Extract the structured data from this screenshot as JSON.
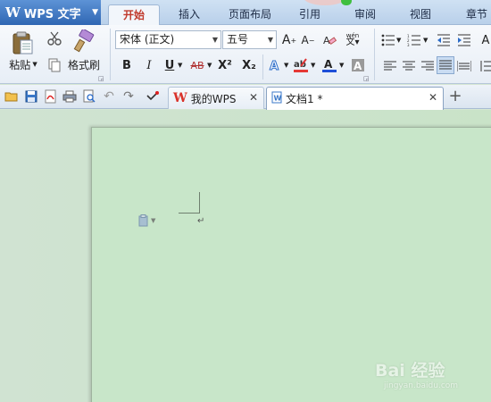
{
  "app": {
    "brand": "WPS 文字",
    "logo_glyph": "W"
  },
  "menu": {
    "tabs": [
      {
        "label": "开始",
        "active": true
      },
      {
        "label": "插入"
      },
      {
        "label": "页面布局"
      },
      {
        "label": "引用"
      },
      {
        "label": "审阅"
      },
      {
        "label": "视图"
      },
      {
        "label": "章节"
      }
    ]
  },
  "ribbon": {
    "paste_label": "粘贴",
    "format_painter_label": "格式刷",
    "font_name": "宋体 (正文)",
    "font_size": "五号",
    "wen_label": "wén",
    "superscript": "X²",
    "subscript": "X₂",
    "bold": "B",
    "italic": "I",
    "underline": "U",
    "strike": "AB",
    "highlight_color": "#e53935",
    "font_color": "#1e4fd8"
  },
  "tabs": {
    "items": [
      {
        "label": "我的WPS",
        "icon": "wps-home-icon"
      },
      {
        "label": "文档1 *",
        "icon": "word-doc-icon",
        "active": true
      }
    ],
    "new_tab": "+"
  },
  "document": {
    "paragraph_mark": "↵"
  },
  "watermark": {
    "text": "Bai 经验",
    "url": "jingyan.baidu.com"
  },
  "colors": {
    "brand": "#2f66b3",
    "active_tab_text": "#c0392b",
    "page_bg": "#c8e6c9"
  }
}
